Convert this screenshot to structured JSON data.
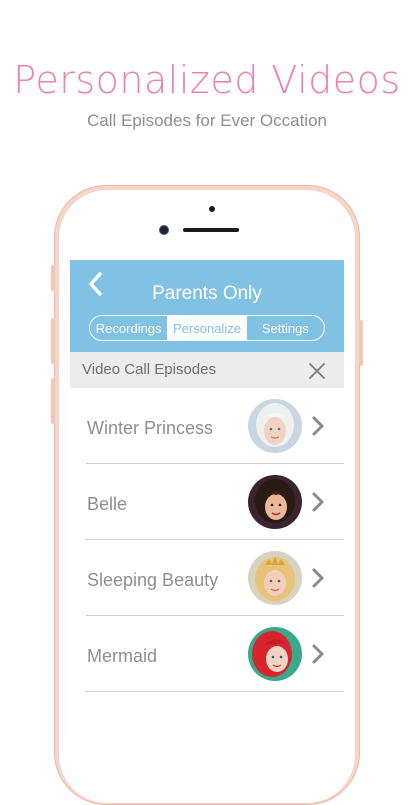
{
  "promo": {
    "headline": "Personalized Videos",
    "subheadline": "Call Episodes for Ever Occation"
  },
  "header": {
    "title": "Parents Only",
    "back_icon": "chevron-left-icon",
    "tabs": [
      {
        "label": "Recordings",
        "active": false
      },
      {
        "label": "Personalize",
        "active": true
      },
      {
        "label": "Settings",
        "active": false
      }
    ]
  },
  "section": {
    "title": "Video Call Episodes",
    "close_icon": "close-icon"
  },
  "episodes": [
    {
      "name": "Winter Princess",
      "avatar": "winter-princess-avatar",
      "chevron": "chevron-right-icon"
    },
    {
      "name": "Belle",
      "avatar": "belle-avatar",
      "chevron": "chevron-right-icon"
    },
    {
      "name": "Sleeping Beauty",
      "avatar": "sleeping-beauty-avatar",
      "chevron": "chevron-right-icon"
    },
    {
      "name": "Mermaid",
      "avatar": "mermaid-avatar",
      "chevron": "chevron-right-icon"
    }
  ],
  "colors": {
    "accent_pink": "#ee7fb4",
    "header_blue": "#80c1e4",
    "section_gray": "#ececec",
    "text_gray": "#8f8f8f",
    "phone_gold": "#f6d6c8"
  }
}
